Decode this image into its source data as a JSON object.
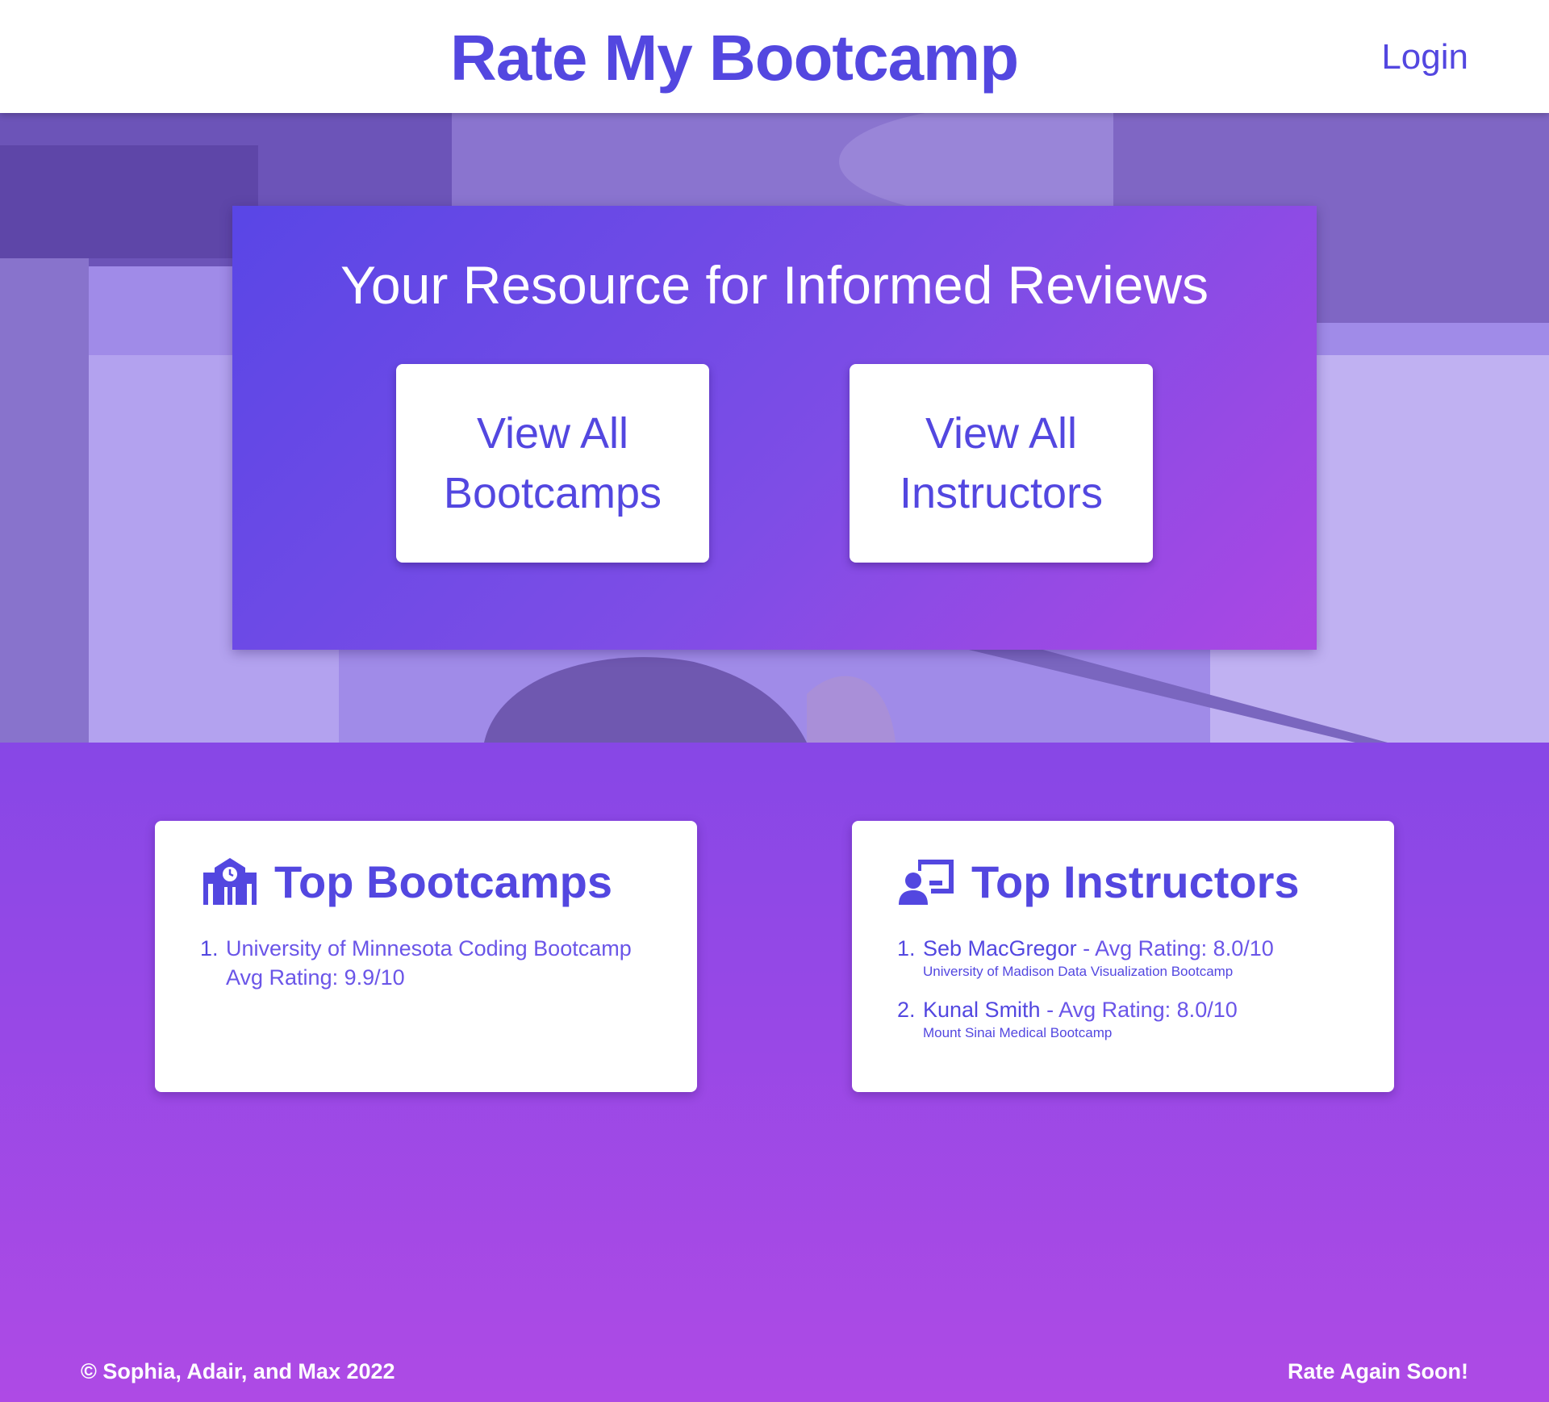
{
  "header": {
    "title": "Rate My Bootcamp",
    "login_label": "Login"
  },
  "hero": {
    "heading": "Your Resource for Informed Reviews",
    "buttons": [
      {
        "line1": "View All",
        "line2": "Bootcamps"
      },
      {
        "line1": "View All",
        "line2": "Instructors"
      }
    ]
  },
  "top_bootcamps": {
    "title": "Top Bootcamps",
    "icon": "school-icon",
    "items": [
      {
        "rank": "1.",
        "name": "University of Minnesota Coding Bootcamp",
        "rating": "Avg Rating: 9.9/10"
      }
    ]
  },
  "top_instructors": {
    "title": "Top Instructors",
    "icon": "chalkboard-teacher-icon",
    "items": [
      {
        "rank": "1.",
        "name": "Seb MacGregor",
        "rating": " - Avg Rating: 8.0/10",
        "bootcamp": "University of Madison Data Visualization Bootcamp"
      },
      {
        "rank": "2.",
        "name": "Kunal Smith",
        "rating": " - Avg Rating: 8.0/10",
        "bootcamp": "Mount Sinai Medical Bootcamp"
      }
    ]
  },
  "footer": {
    "copyright": "© Sophia, Adair, and Max 2022",
    "tagline": "Rate Again Soon!"
  },
  "colors": {
    "brand": "#5347e0",
    "hero_gradient_start": "#5946e6",
    "hero_gradient_end": "#ab47e3",
    "lower_gradient_start": "#8747e6",
    "lower_gradient_end": "#ae4ae5"
  }
}
